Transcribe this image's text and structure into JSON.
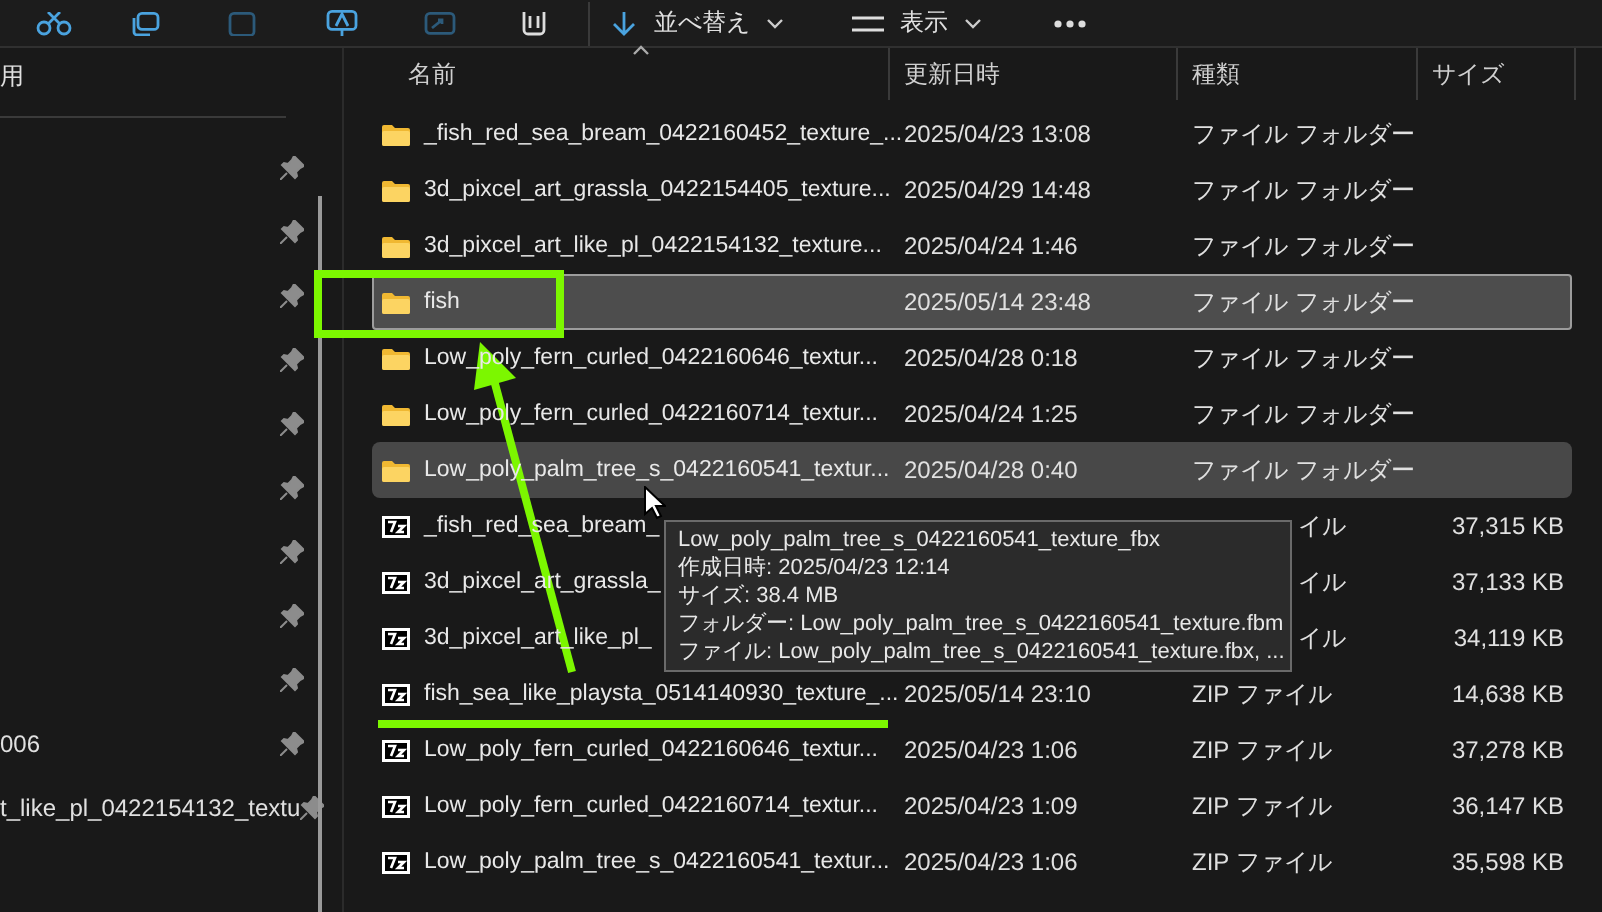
{
  "toolbar": {
    "sort_label": "並べ替え",
    "view_label": "表示"
  },
  "sidebar": {
    "top_item": {
      "label": "用"
    },
    "items": [
      {
        "pinned": true
      },
      {
        "pinned": true
      },
      {
        "pinned": true
      },
      {
        "pinned": true
      },
      {
        "pinned": true
      },
      {
        "pinned": true
      },
      {
        "pinned": true
      },
      {
        "pinned": true
      },
      {
        "pinned": true
      },
      {
        "label": "006",
        "pinned": true
      },
      {
        "label": "t_like_pl_0422154132_textu",
        "pinned": true
      }
    ]
  },
  "table": {
    "columns": [
      "名前",
      "更新日時",
      "種類",
      "サイズ"
    ],
    "rows": [
      {
        "kind": "folder",
        "name": "_fish_red_sea_bream_0422160452_texture_...",
        "date": "2025/04/23 13:08",
        "type": "ファイル フォルダー",
        "selected": false,
        "hovered": false
      },
      {
        "kind": "folder",
        "name": "3d_pixcel_art_grassla_0422154405_texture...",
        "date": "2025/04/29 14:48",
        "type": "ファイル フォルダー",
        "selected": false,
        "hovered": false
      },
      {
        "kind": "folder",
        "name": "3d_pixcel_art_like_pl_0422154132_texture...",
        "date": "2025/04/24 1:46",
        "type": "ファイル フォルダー",
        "selected": false,
        "hovered": false
      },
      {
        "kind": "folder",
        "name": "fish",
        "date": "2025/05/14 23:48",
        "type": "ファイル フォルダー",
        "selected": true,
        "hovered": false
      },
      {
        "kind": "folder",
        "name": "Low_poly_fern_curled_0422160646_textur...",
        "date": "2025/04/28 0:18",
        "type": "ファイル フォルダー",
        "selected": false,
        "hovered": false
      },
      {
        "kind": "folder",
        "name": "Low_poly_fern_curled_0422160714_textur...",
        "date": "2025/04/24 1:25",
        "type": "ファイル フォルダー",
        "selected": false,
        "hovered": false
      },
      {
        "kind": "folder",
        "name": "Low_poly_palm_tree_s_0422160541_textur...",
        "date": "2025/04/28 0:40",
        "type": "ファイル フォルダー",
        "selected": false,
        "hovered": true
      },
      {
        "kind": "zip",
        "name": "_fish_red_sea_bream_",
        "type": "イル",
        "size": "37,315 KB",
        "selected": false,
        "hovered": false,
        "covered": true
      },
      {
        "kind": "zip",
        "name": "3d_pixcel_art_grassla_",
        "type": "イル",
        "size": "37,133 KB",
        "selected": false,
        "hovered": false,
        "covered": true
      },
      {
        "kind": "zip",
        "name": "3d_pixcel_art_like_pl_",
        "type": "イル",
        "size": "34,119 KB",
        "selected": false,
        "hovered": false,
        "covered": true
      },
      {
        "kind": "zip",
        "name": "fish_sea_like_playsta_0514140930_texture_...",
        "date": "2025/05/14 23:10",
        "type": "ZIP ファイル",
        "size": "14,638 KB",
        "selected": false,
        "hovered": false
      },
      {
        "kind": "zip",
        "name": "Low_poly_fern_curled_0422160646_textur...",
        "date": "2025/04/23 1:06",
        "type": "ZIP ファイル",
        "size": "37,278 KB",
        "selected": false,
        "hovered": false
      },
      {
        "kind": "zip",
        "name": "Low_poly_fern_curled_0422160714_textur...",
        "date": "2025/04/23 1:09",
        "type": "ZIP ファイル",
        "size": "36,147 KB",
        "selected": false,
        "hovered": false
      },
      {
        "kind": "zip",
        "name": "Low_poly_palm_tree_s_0422160541_textur...",
        "date": "2025/04/23 1:06",
        "type": "ZIP ファイル",
        "size": "35,598 KB",
        "selected": false,
        "hovered": false
      }
    ]
  },
  "tooltip": {
    "lines": [
      "Low_poly_palm_tree_s_0422160541_texture_fbx",
      "作成日時: 2025/04/23 12:14",
      "サイズ: 38.4 MB",
      "フォルダー: Low_poly_palm_tree_s_0422160541_texture.fbm",
      "ファイル: Low_poly_palm_tree_s_0422160541_texture.fbx, ..."
    ]
  },
  "annotations": [
    {
      "kind": "box"
    },
    {
      "kind": "arrow"
    },
    {
      "kind": "underline"
    }
  ]
}
